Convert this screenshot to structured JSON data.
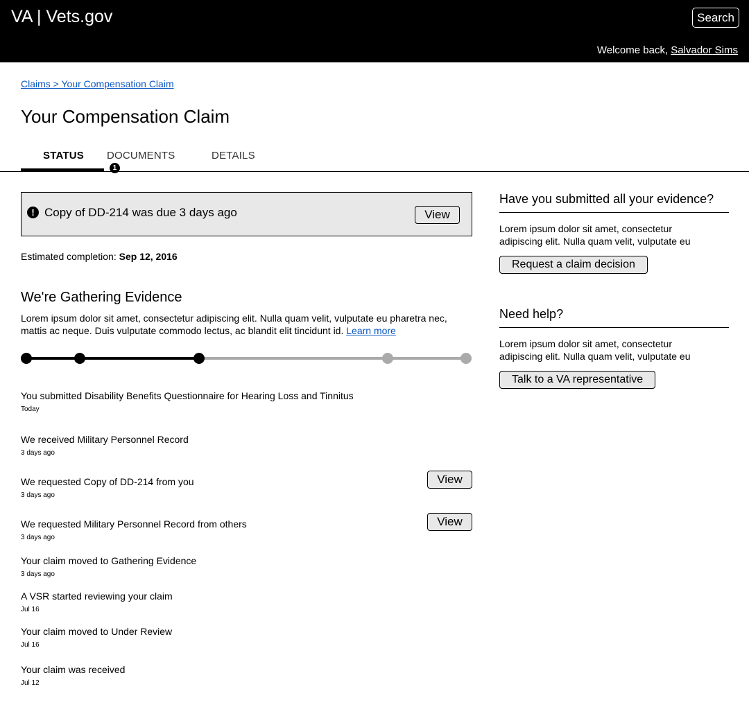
{
  "header": {
    "brand": "VA | Vets.gov",
    "search_label": "Search",
    "welcome_prefix": "Welcome back, ",
    "user_name": "Salvador Sims"
  },
  "breadcrumb": "Claims > Your Compensation Claim",
  "page_title": "Your Compensation Claim",
  "tabs": [
    {
      "label": "STATUS",
      "active": true
    },
    {
      "label": "DOCUMENTS",
      "badge": "1"
    },
    {
      "label": "DETAILS"
    }
  ],
  "alert": {
    "icon": "exclamation-icon",
    "icon_glyph": "!",
    "text": "Copy of DD-214 was due 3 days ago",
    "button": "View"
  },
  "estimate": {
    "label": "Estimated completion: ",
    "date": "Sep 12, 2016"
  },
  "section": {
    "heading": "We're Gathering Evidence",
    "body": "Lorem ipsum dolor sit amet, consectetur adipiscing elit. Nulla quam velit, vulputate eu pharetra nec, mattis ac neque. Duis vulputate commodo lectus, ac blandit elit tincidunt id.",
    "link": "Learn more"
  },
  "progress": {
    "total_steps": 5,
    "current_step": 3,
    "complete_color": "#000000",
    "incomplete_color": "#aaaaaa"
  },
  "timeline": [
    {
      "title": "You submitted Disability Benefits Questionnaire for Hearing Loss and Tinnitus",
      "date": "Today"
    },
    {
      "title": "We received Military Personnel Record",
      "date": "3 days ago"
    },
    {
      "title": "We requested Copy of DD-214 from you",
      "date": "3 days ago",
      "button": "View"
    },
    {
      "title": "We requested Military Personnel Record from others",
      "date": "3 days ago",
      "button": "View"
    },
    {
      "title": "Your claim moved to Gathering Evidence",
      "date": "3 days ago"
    },
    {
      "title": "A VSR started reviewing your claim",
      "date": "Jul 16"
    },
    {
      "title": "Your claim moved to Under Review",
      "date": "Jul 16"
    },
    {
      "title": "Your claim was received",
      "date": "Jul 12"
    }
  ],
  "sidebar": {
    "evidence": {
      "heading": "Have you submitted all your evidence?",
      "text": "Lorem ipsum dolor sit amet, consectetur adipiscing elit. Nulla quam velit, vulputate eu",
      "button": "Request a claim decision"
    },
    "help": {
      "heading": "Need help?",
      "text": "Lorem ipsum dolor sit amet, consectetur adipiscing elit. Nulla quam velit, vulputate eu",
      "button": "Talk to a VA representative"
    }
  }
}
